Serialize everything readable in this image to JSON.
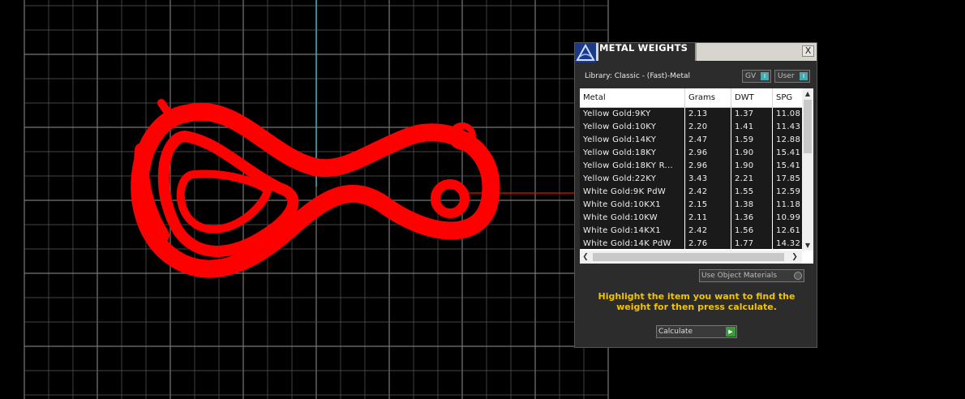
{
  "viewport": {
    "object_color": "#ff0000",
    "grid_color": "#5a5a5a",
    "axis_color": "#4aa8c0"
  },
  "dialog": {
    "title": "METAL WEIGHTS",
    "close_label": "X",
    "logo_icon": "app-logo-icon",
    "library_label": "Library: Classic - (Fast)-Metal",
    "toggles": [
      {
        "label": "GV",
        "knob": "I"
      },
      {
        "label": "User",
        "knob": "I"
      }
    ],
    "table": {
      "columns": [
        "Metal",
        "Grams",
        "DWT",
        "SPG"
      ],
      "rows": [
        {
          "metal": "Yellow Gold:9KY",
          "grams": "2.13",
          "dwt": "1.37",
          "spg": "11.08"
        },
        {
          "metal": "Yellow Gold:10KY",
          "grams": "2.20",
          "dwt": "1.41",
          "spg": "11.43"
        },
        {
          "metal": "Yellow Gold:14KY",
          "grams": "2.47",
          "dwt": "1.59",
          "spg": "12.88"
        },
        {
          "metal": "Yellow Gold:18KY",
          "grams": "2.96",
          "dwt": "1.90",
          "spg": "15.41"
        },
        {
          "metal": "Yellow Gold:18KY R...",
          "grams": "2.96",
          "dwt": "1.90",
          "spg": "15.41"
        },
        {
          "metal": "Yellow Gold:22KY",
          "grams": "3.43",
          "dwt": "2.21",
          "spg": "17.85"
        },
        {
          "metal": "White Gold:9K PdW",
          "grams": "2.42",
          "dwt": "1.55",
          "spg": "12.59"
        },
        {
          "metal": "White Gold:10KX1",
          "grams": "2.15",
          "dwt": "1.38",
          "spg": "11.18"
        },
        {
          "metal": "White Gold:10KW",
          "grams": "2.11",
          "dwt": "1.36",
          "spg": "10.99"
        },
        {
          "metal": "White Gold:14KX1",
          "grams": "2.42",
          "dwt": "1.56",
          "spg": "12.61"
        },
        {
          "metal": "White Gold:14K PdW",
          "grams": "2.76",
          "dwt": "1.77",
          "spg": "14.32"
        }
      ]
    },
    "use_object_materials": "Use Object Materials",
    "hint": "Highlight the item you want to find the weight for then press calculate.",
    "calculate_label": "Calculate"
  }
}
